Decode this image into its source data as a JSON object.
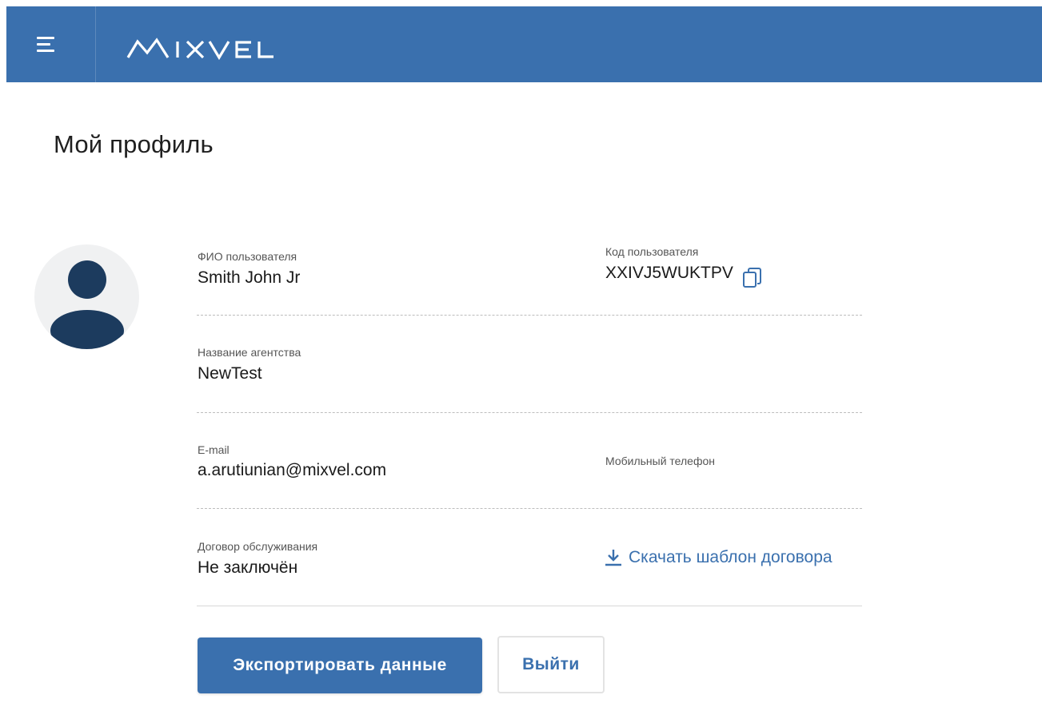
{
  "header": {
    "brand": "MIXVEL",
    "background_color": "#3a70ae",
    "menu_icon": "hamburger-menu-icon"
  },
  "page": {
    "title": "Мой профиль"
  },
  "profile": {
    "avatar_icon": "user-avatar-icon",
    "full_name": {
      "label": "ФИО пользователя",
      "value": "Smith John Jr"
    },
    "user_code": {
      "label": "Код пользователя",
      "value": "XXIVJ5WUKTPV",
      "copy_icon": "copy-icon"
    },
    "agency": {
      "label": "Название агентства",
      "value": "NewTest"
    },
    "email": {
      "label": "E-mail",
      "value": "a.arutiunian@mixvel.com"
    },
    "mobile_phone": {
      "label": "Мобильный телефон",
      "value": ""
    },
    "contract": {
      "label": "Договор обслуживания",
      "value": "Не заключён",
      "download_label": "Скачать шаблон договора",
      "download_icon": "download-icon"
    }
  },
  "actions": {
    "export_label": "Экспортировать данные",
    "logout_label": "Выйти"
  },
  "colors": {
    "accent": "#3a70ae",
    "avatar_fill": "#1c3b5e",
    "avatar_bg": "#f0f1f2"
  }
}
